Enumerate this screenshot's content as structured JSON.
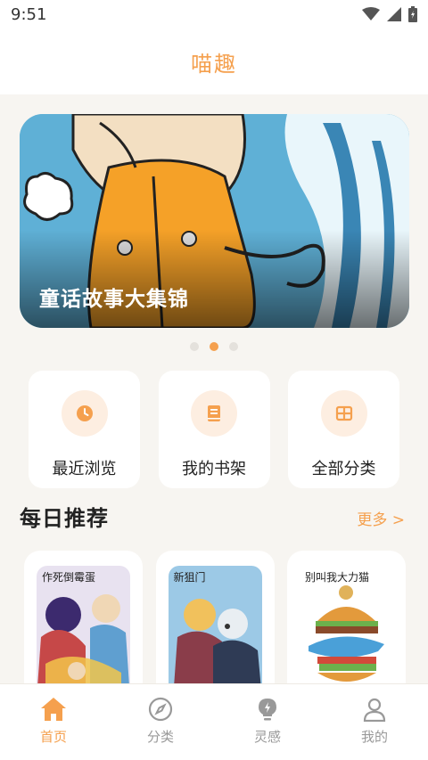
{
  "status_bar": {
    "time": "9:51"
  },
  "header": {
    "title": "喵趣"
  },
  "banner": {
    "caption": "童话故事大集锦",
    "slide_count": 3,
    "active_slide": 2
  },
  "quick_entries": [
    {
      "label": "最近浏览",
      "icon": "clock-icon"
    },
    {
      "label": "我的书架",
      "icon": "book-icon"
    },
    {
      "label": "全部分类",
      "icon": "grid-icon"
    }
  ],
  "daily": {
    "title": "每日推荐",
    "more_label": "更多 >",
    "items": [
      {
        "cover_title": "作死倒霉蛋"
      },
      {
        "cover_title": "新狙门"
      },
      {
        "cover_title": "别叫我大力猫"
      }
    ]
  },
  "bottom_nav": [
    {
      "label": "首页",
      "icon": "home-icon",
      "active": true
    },
    {
      "label": "分类",
      "icon": "compass-icon",
      "active": false
    },
    {
      "label": "灵感",
      "icon": "bulb-icon",
      "active": false
    },
    {
      "label": "我的",
      "icon": "user-icon",
      "active": false
    }
  ],
  "colors": {
    "accent": "#f5a04e",
    "accent_light": "#fdeee1",
    "background": "#f7f5f1",
    "inactive": "#999999"
  }
}
